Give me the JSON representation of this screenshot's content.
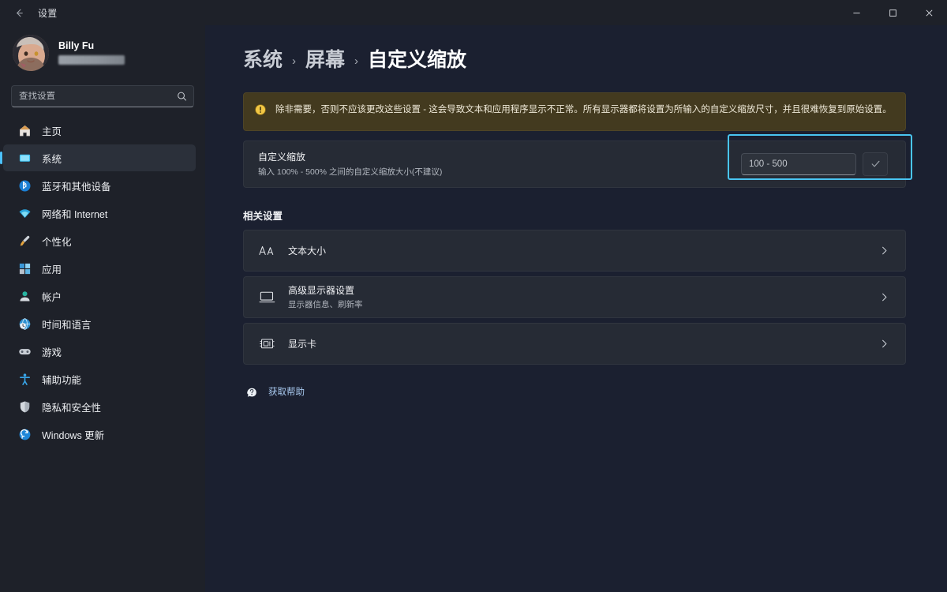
{
  "window": {
    "title": "设置",
    "back_icon": "back-arrow-icon",
    "controls": {
      "minimize": "minimize-icon",
      "maximize": "maximize-icon",
      "close": "close-icon"
    }
  },
  "sidebar": {
    "account": {
      "name": "Billy Fu",
      "email_redacted": ""
    },
    "search": {
      "placeholder": "查找设置",
      "value": "",
      "icon": "search-icon"
    },
    "items": [
      {
        "label": "主页",
        "icon": "home-icon",
        "selected": false
      },
      {
        "label": "系统",
        "icon": "system-icon",
        "selected": true
      },
      {
        "label": "蓝牙和其他设备",
        "icon": "bluetooth-icon",
        "selected": false
      },
      {
        "label": "网络和 Internet",
        "icon": "wifi-icon",
        "selected": false
      },
      {
        "label": "个性化",
        "icon": "brush-icon",
        "selected": false
      },
      {
        "label": "应用",
        "icon": "apps-icon",
        "selected": false
      },
      {
        "label": "帐户",
        "icon": "account-icon",
        "selected": false
      },
      {
        "label": "时间和语言",
        "icon": "clock-globe-icon",
        "selected": false
      },
      {
        "label": "游戏",
        "icon": "gamepad-icon",
        "selected": false
      },
      {
        "label": "辅助功能",
        "icon": "accessibility-icon",
        "selected": false
      },
      {
        "label": "隐私和安全性",
        "icon": "shield-icon",
        "selected": false
      },
      {
        "label": "Windows 更新",
        "icon": "update-icon",
        "selected": false
      }
    ]
  },
  "main": {
    "breadcrumb": {
      "parent": "系统",
      "middle": "屏幕",
      "current": "自定义缩放",
      "separator": "›"
    },
    "warning": {
      "icon": "warning-icon",
      "text": "除非需要，否则不应该更改这些设置 - 这会导致文本和应用程序显示不正常。所有显示器都将设置为所输入的自定义缩放尺寸，并且很难恢复到原始设置。",
      "bg_color": "#433a1f"
    },
    "custom_scaling": {
      "title": "自定义缩放",
      "subtitle": "输入 100% - 500% 之间的自定义缩放大小(不建议)",
      "input_placeholder": "100 - 500",
      "input_value": "",
      "confirm_icon": "checkmark-icon",
      "focus_ring_color": "#49c5f2"
    },
    "related": {
      "heading": "相关设置",
      "rows": [
        {
          "title": "文本大小",
          "subtitle": "",
          "icon": "text-size-icon",
          "chevron": "chevron-right-icon"
        },
        {
          "title": "高级显示器设置",
          "subtitle": "显示器信息、刷新率",
          "icon": "monitor-icon",
          "chevron": "chevron-right-icon"
        },
        {
          "title": "显示卡",
          "subtitle": "",
          "icon": "graphics-card-icon",
          "chevron": "chevron-right-icon"
        }
      ]
    },
    "help": {
      "label": "获取帮助",
      "icon": "help-icon",
      "color": "#a8c9ef"
    }
  },
  "theme": {
    "sidebar_bg": "#1e2129",
    "main_bg": "#1b2030",
    "card_bg": "#262b35",
    "accent": "#4cc2ff",
    "warning_yellow": "#f2c744"
  }
}
